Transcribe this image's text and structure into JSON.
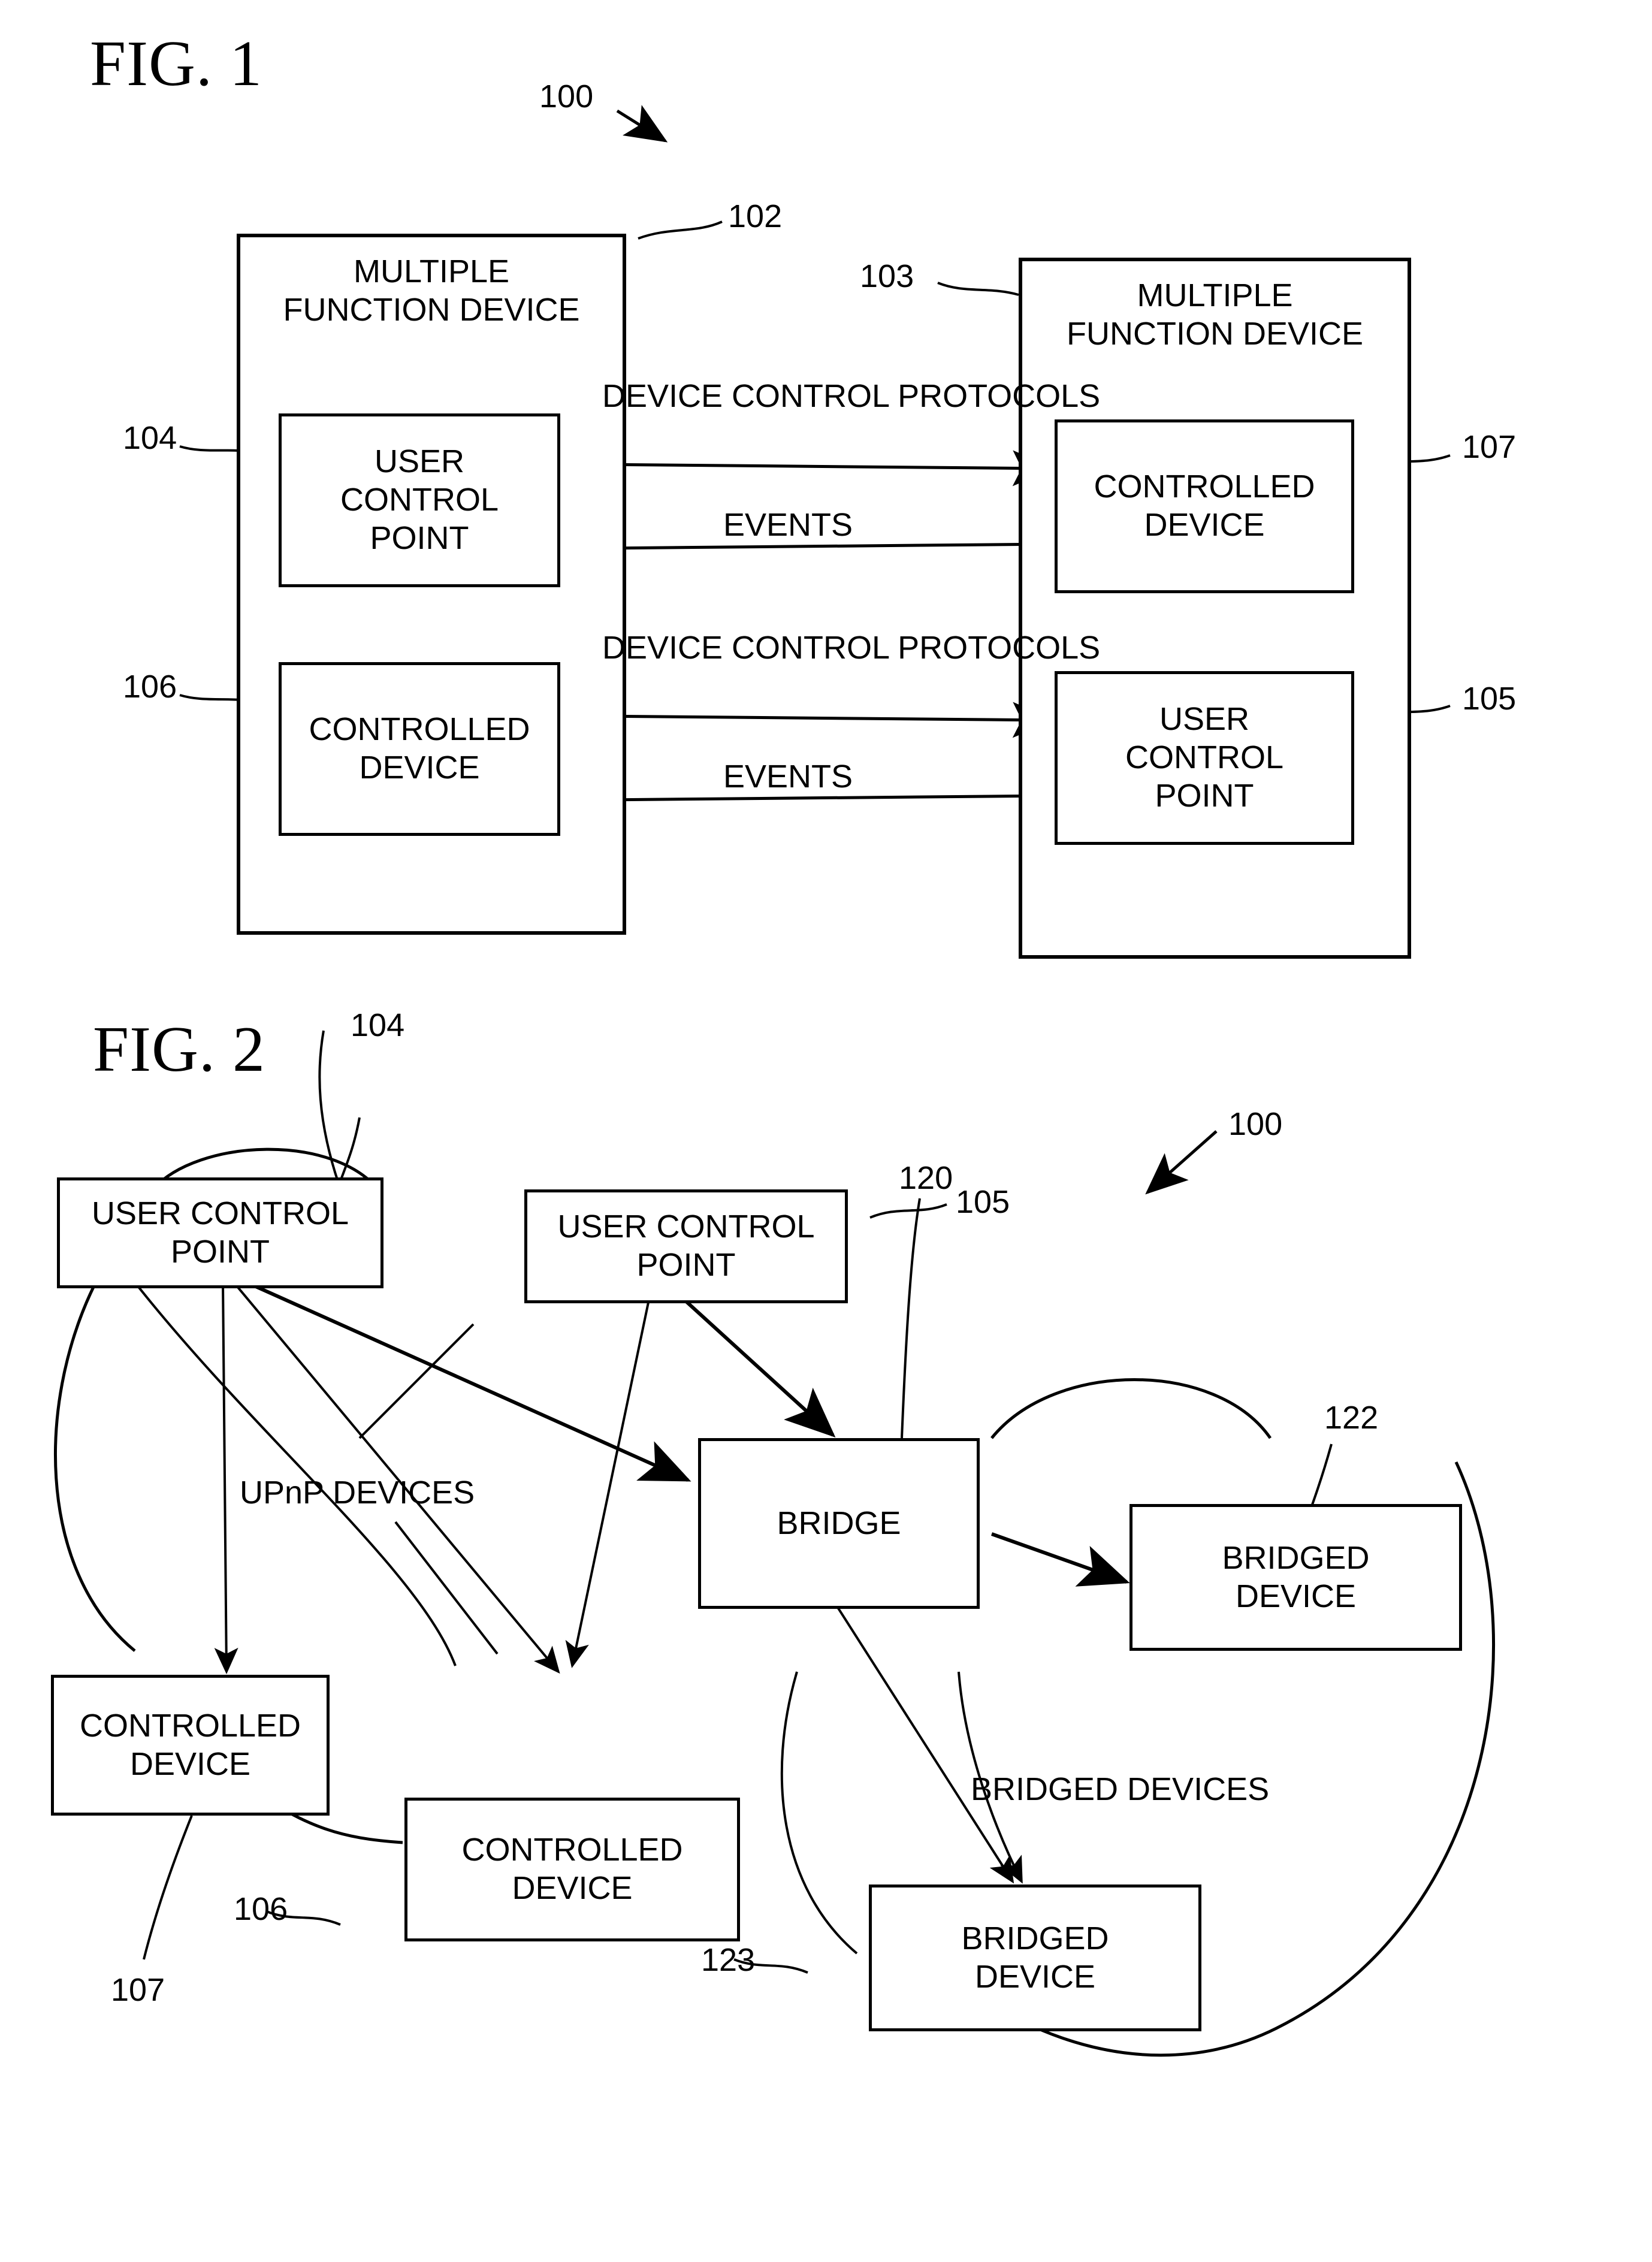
{
  "sheet": {
    "background": "#ffffff",
    "ink": "#000000"
  },
  "figures": [
    {
      "id": "fig1",
      "title": "FIG. 1",
      "system_ref": "100",
      "nodes": [
        {
          "key": "mfd_left",
          "label": "MULTIPLE\nFUNCTION DEVICE",
          "ref": "102"
        },
        {
          "key": "mfd_right",
          "label": "MULTIPLE\nFUNCTION DEVICE",
          "ref": "103"
        },
        {
          "key": "ucp_left",
          "label": "USER\nCONTROL\nPOINT",
          "ref": "104"
        },
        {
          "key": "cd_right",
          "label": "CONTROLLED\nDEVICE",
          "ref": "107"
        },
        {
          "key": "cd_left",
          "label": "CONTROLLED\nDEVICE",
          "ref": "106"
        },
        {
          "key": "ucp_right",
          "label": "USER\nCONTROL\nPOINT",
          "ref": "105"
        }
      ],
      "flows": [
        {
          "key": "dcp_top",
          "label": "DEVICE CONTROL\nPROTOCOLS",
          "direction": "right"
        },
        {
          "key": "events_top",
          "label": "EVENTS",
          "direction": "left"
        },
        {
          "key": "dcp_bot",
          "label": "DEVICE CONTROL\nPROTOCOLS",
          "direction": "right"
        },
        {
          "key": "events_bot",
          "label": "EVENTS",
          "direction": "left"
        }
      ]
    },
    {
      "id": "fig2",
      "title": "FIG. 2",
      "system_ref": "100",
      "nodes": [
        {
          "key": "ucp_1",
          "label": "USER CONTROL\nPOINT",
          "ref": "104"
        },
        {
          "key": "ucp_2",
          "label": "USER CONTROL\nPOINT",
          "ref": "105"
        },
        {
          "key": "bridge",
          "label": "BRIDGE",
          "ref": "120"
        },
        {
          "key": "bdev_1",
          "label": "BRIDGED\nDEVICE",
          "ref": "122"
        },
        {
          "key": "cdev_1",
          "label": "CONTROLLED\nDEVICE",
          "ref": "107"
        },
        {
          "key": "cdev_2",
          "label": "CONTROLLED\nDEVICE",
          "ref": "106"
        },
        {
          "key": "bdev_2",
          "label": "BRIDGED\nDEVICE",
          "ref": "123"
        }
      ],
      "annotations": [
        {
          "key": "upnp_devices",
          "label": "UPnP DEVICES"
        },
        {
          "key": "bridged_devices",
          "label": "BRIDGED DEVICES"
        }
      ]
    }
  ]
}
